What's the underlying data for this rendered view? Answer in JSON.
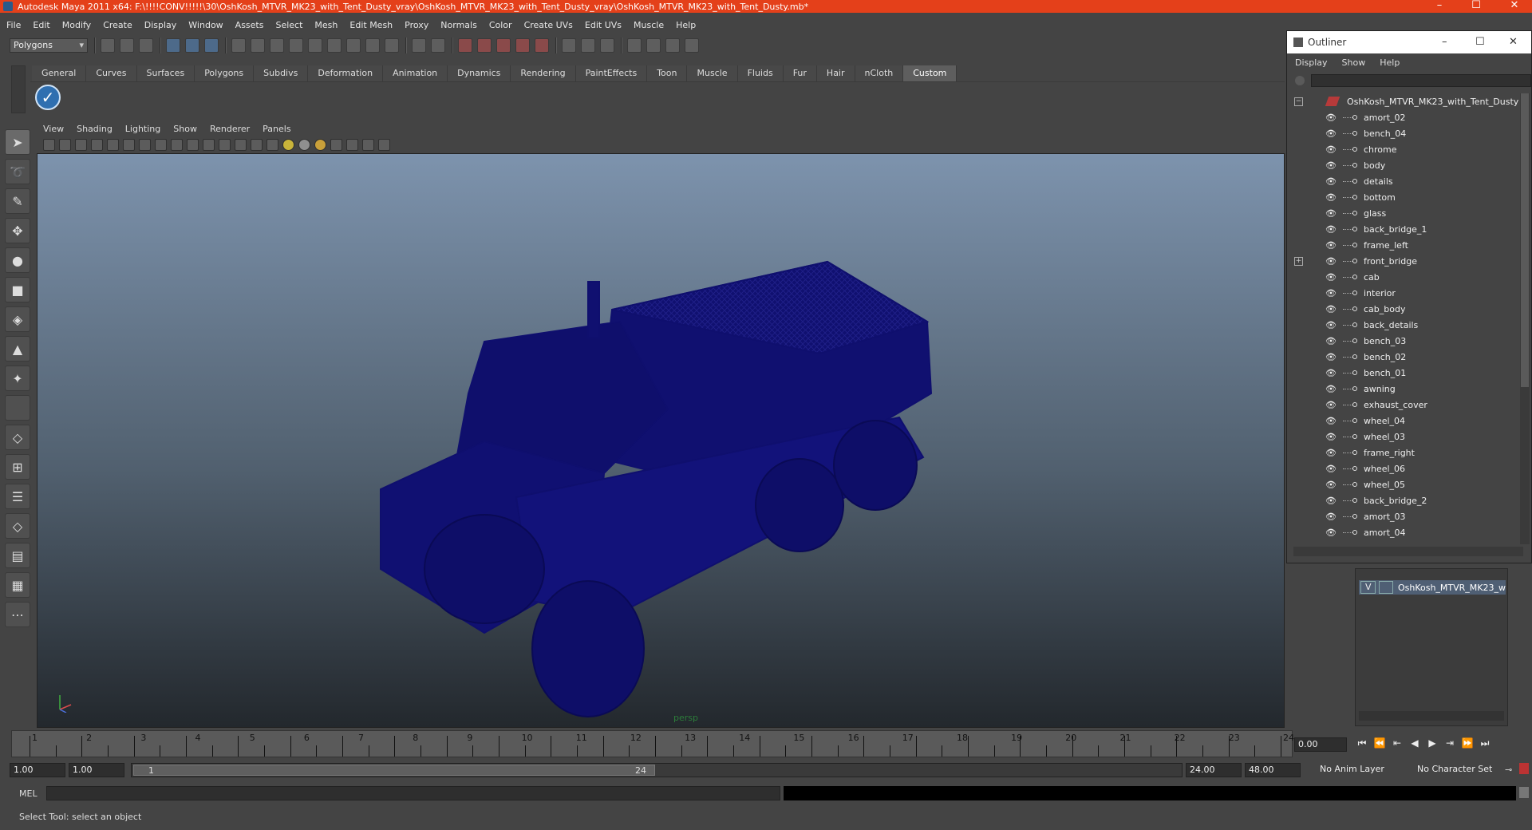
{
  "window": {
    "title": "Autodesk Maya 2011 x64: F:\\!!!!CONV!!!!!\\30\\OshKosh_MTVR_MK23_with_Tent_Dusty_vray\\OshKosh_MTVR_MK23_with_Tent_Dusty_vray\\OshKosh_MTVR_MK23_with_Tent_Dusty.mb*",
    "accent": "#e4401a"
  },
  "menus": [
    "File",
    "Edit",
    "Modify",
    "Create",
    "Display",
    "Window",
    "Assets",
    "Select",
    "Mesh",
    "Edit Mesh",
    "Proxy",
    "Normals",
    "Color",
    "Create UVs",
    "Edit UVs",
    "Muscle",
    "Help"
  ],
  "status": {
    "mode": "Polygons"
  },
  "shelf": {
    "tabs": [
      "General",
      "Curves",
      "Surfaces",
      "Polygons",
      "Subdivs",
      "Deformation",
      "Animation",
      "Dynamics",
      "Rendering",
      "PaintEffects",
      "Toon",
      "Muscle",
      "Fluids",
      "Fur",
      "Hair",
      "nCloth",
      "Custom"
    ],
    "active_tab": "Custom"
  },
  "viewport": {
    "menus": [
      "View",
      "Shading",
      "Lighting",
      "Show",
      "Renderer",
      "Panels"
    ],
    "camera": "persp",
    "wire_color": "#0f0f6e"
  },
  "outliner": {
    "title": "Outliner",
    "menus": [
      "Display",
      "Show",
      "Help"
    ],
    "root": "OshKosh_MTVR_MK23_with_Tent_Dusty",
    "items": [
      "amort_02",
      "bench_04",
      "chrome",
      "body",
      "details",
      "bottom",
      "glass",
      "back_bridge_1",
      "frame_left",
      "front_bridge",
      "cab",
      "interior",
      "cab_body",
      "back_details",
      "bench_03",
      "bench_02",
      "bench_01",
      "awning",
      "exhaust_cover",
      "wheel_04",
      "wheel_03",
      "frame_right",
      "wheel_06",
      "wheel_05",
      "back_bridge_2",
      "amort_03",
      "amort_04"
    ]
  },
  "layer": {
    "visible": "V",
    "name": "OshKosh_MTVR_MK23_w"
  },
  "timeline": {
    "ticks": [
      "1",
      "2",
      "3",
      "4",
      "5",
      "6",
      "7",
      "8",
      "9",
      "10",
      "11",
      "12",
      "13",
      "14",
      "15",
      "16",
      "17",
      "18",
      "19",
      "20",
      "21",
      "22",
      "23",
      "24"
    ],
    "current_time": "0.00"
  },
  "range": {
    "start_field": "1.00",
    "start_field2": "1.00",
    "thumb_start": "1",
    "thumb_end": "24",
    "end_field": "24.00",
    "end_field2": "48.00",
    "anim_layer": "No Anim Layer",
    "char_set": "No Character Set"
  },
  "cmd": {
    "label": "MEL"
  },
  "help": {
    "text": "Select Tool: select an object"
  }
}
